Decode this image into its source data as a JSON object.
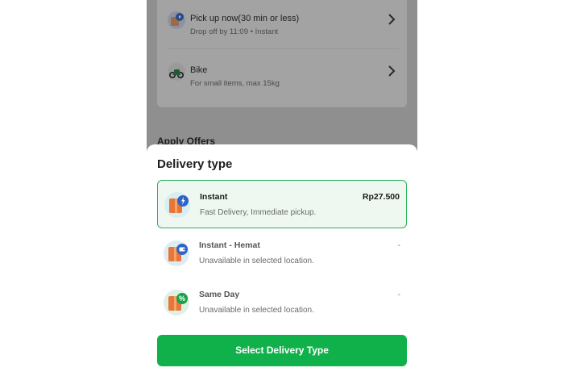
{
  "background": {
    "delivery_options": [
      {
        "title": "Pick up now(30 min or less)",
        "subtitle": "Drop off by 11:09 • Instant",
        "icon": "parcel-lightning-icon"
      },
      {
        "title": "Bike",
        "subtitle": "For small items, max 15kg",
        "icon": "motorbike-icon"
      }
    ],
    "apply_offers_label": "Apply Offers"
  },
  "sheet": {
    "title": "Delivery type",
    "options": [
      {
        "name": "Instant",
        "description": "Fast Delivery, Immediate pickup.",
        "price": "Rp27.500",
        "selected": true,
        "icon": "parcel-lightning-icon"
      },
      {
        "name": "Instant - Hemat",
        "description": "Unavailable in selected location.",
        "price": "-",
        "selected": false,
        "icon": "parcel-wallet-icon"
      },
      {
        "name": "Same Day",
        "description": "Unavailable in selected location.",
        "price": "-",
        "selected": false,
        "icon": "parcel-percent-icon"
      }
    ],
    "cta_label": "Select Delivery Type"
  },
  "colors": {
    "accent_green": "#10b14a",
    "selected_border": "#2db25a",
    "selected_background": "#eef8f1",
    "overlay": "#8f8f8f"
  }
}
